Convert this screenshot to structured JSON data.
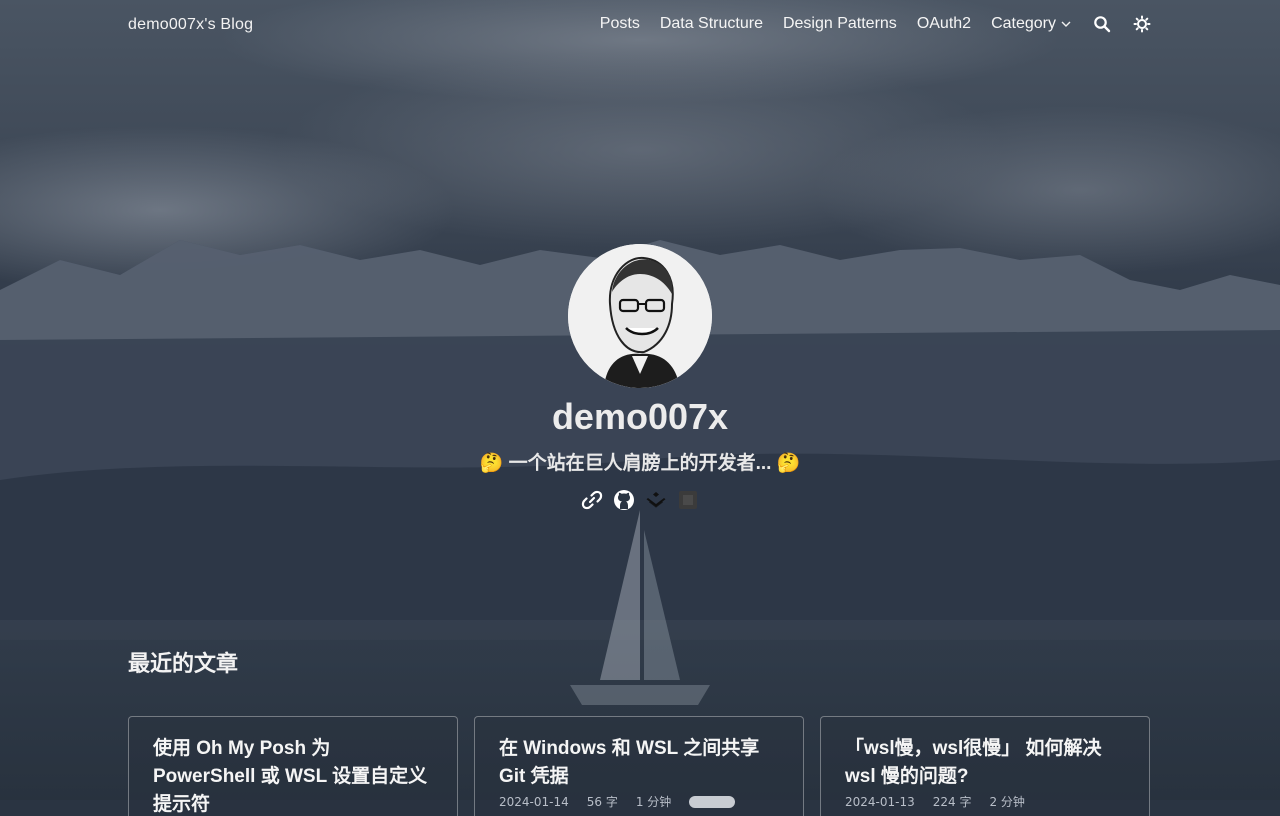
{
  "site": {
    "brand": "demo007x's Blog"
  },
  "nav": {
    "items": [
      {
        "label": "Posts"
      },
      {
        "label": "Data Structure"
      },
      {
        "label": "Design Patterns"
      },
      {
        "label": "OAuth2"
      },
      {
        "label": "Category"
      }
    ],
    "icons": [
      "search-icon",
      "theme-toggle-icon"
    ]
  },
  "hero": {
    "author": "demo007x",
    "subtitle": "🤔 一个站在巨人肩膀上的开发者... 🤔",
    "social_icons": [
      "link-icon",
      "github-icon",
      "juejin-icon",
      "square-icon"
    ]
  },
  "recent": {
    "title": "最近的文章",
    "posts": [
      {
        "title": "使用 Oh My Posh 为 PowerShell 或 WSL 设置自定义提示符",
        "meta": ""
      },
      {
        "title": "在 Windows 和 WSL 之间共享 Git 凭据",
        "date": "2024-01-14",
        "words": "56 字",
        "read": "1 分钟"
      },
      {
        "title": "「wsl慢，wsl很慢」 如何解决 wsl 慢的问题?",
        "date": "2024-01-13",
        "words": "224 字",
        "read": "2 分钟"
      }
    ]
  },
  "colors": {
    "accent": "#ffffff",
    "background": "#2a3442"
  }
}
